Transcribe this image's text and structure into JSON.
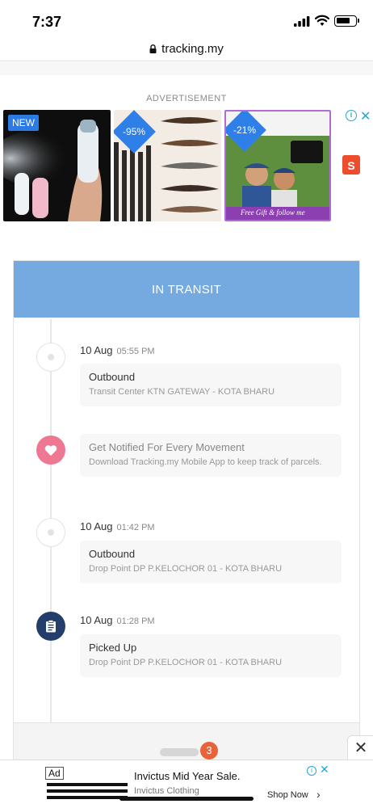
{
  "status_bar": {
    "time": "7:37",
    "battery_level": 0.75
  },
  "browser": {
    "url": "tracking.my"
  },
  "advertisement": {
    "label": "ADVERTISEMENT",
    "tiles": [
      {
        "badge": "NEW"
      },
      {
        "badge": "-95%"
      },
      {
        "badge": "-21%",
        "caption": "Free Gift & follow me"
      }
    ]
  },
  "tracking": {
    "status": "IN TRANSIT",
    "events": [
      {
        "date": "10 Aug",
        "time": "05:55 PM",
        "title": "Outbound",
        "detail": "Transit Center KTN GATEWAY - KOTA BHARU",
        "icon": "dot-icon"
      },
      {
        "date": "",
        "time": "",
        "title": "Get Notified For Every Movement",
        "detail": "Download Tracking.my Mobile App to keep track of parcels.",
        "icon": "heart-icon"
      },
      {
        "date": "10 Aug",
        "time": "01:42 PM",
        "title": "Outbound",
        "detail": "Drop Point DP P.KELOCHOR 01 - KOTA BHARU",
        "icon": "dot-icon"
      },
      {
        "date": "10 Aug",
        "time": "01:28 PM",
        "title": "Picked Up",
        "detail": "Drop Point DP P.KELOCHOR 01 - KOTA BHARU",
        "icon": "clipboard-icon"
      }
    ]
  },
  "overlay": {
    "badge_count": "3"
  },
  "bottom_ad": {
    "badge": "Ad",
    "title": "Invictus Mid Year Sale.",
    "brand": "Invictus Clothing",
    "cta": "Shop Now"
  }
}
